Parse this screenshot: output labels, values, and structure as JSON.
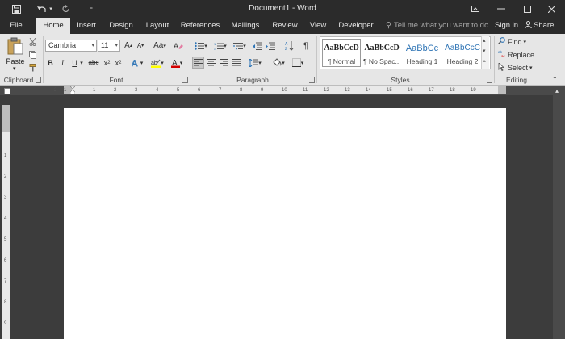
{
  "window": {
    "title": "Document1 - Word"
  },
  "quick_access": {
    "save_icon": "save-icon",
    "undo_icon": "undo-icon",
    "redo_icon": "redo-icon",
    "customize_icon": "customize-icon"
  },
  "tabs": [
    {
      "label": "File"
    },
    {
      "label": "Home"
    },
    {
      "label": "Insert"
    },
    {
      "label": "Design"
    },
    {
      "label": "Layout"
    },
    {
      "label": "References"
    },
    {
      "label": "Mailings"
    },
    {
      "label": "Review"
    },
    {
      "label": "View"
    },
    {
      "label": "Developer"
    }
  ],
  "tell_me": "Tell me what you want to do...",
  "signin": "Sign in",
  "share": "Share",
  "clipboard": {
    "paste_label": "Paste",
    "group_label": "Clipboard"
  },
  "font": {
    "font_name": "Cambria",
    "font_size": "11",
    "group_label": "Font",
    "case_label": "Aa"
  },
  "paragraph": {
    "group_label": "Paragraph"
  },
  "styles": {
    "group_label": "Styles",
    "items": [
      {
        "preview": "AaBbCcD",
        "name": "¶ Normal"
      },
      {
        "preview": "AaBbCcD",
        "name": "¶ No Spac..."
      },
      {
        "preview": "AaBbCc",
        "name": "Heading 1"
      },
      {
        "preview": "AaBbCcC",
        "name": "Heading 2"
      }
    ]
  },
  "editing": {
    "find": "Find",
    "replace": "Replace",
    "select": "Select",
    "group_label": "Editing"
  },
  "ruler": {
    "h_ticks": [
      "2",
      "1",
      "1",
      "2",
      "3",
      "4",
      "5",
      "6",
      "7",
      "8",
      "9",
      "10",
      "11",
      "12",
      "13",
      "14",
      "15",
      "16",
      "17",
      "18",
      "19"
    ],
    "v_ticks": [
      "1",
      "2",
      "3",
      "4",
      "5",
      "6",
      "7",
      "8",
      "9"
    ]
  },
  "colors": {
    "titlebar": "#2b2b2b",
    "ribbon": "#e6e6e6",
    "workspace": "#3c3c3c",
    "page": "#ffffff",
    "heading_blue": "#2e74b5",
    "font_color_red": "#d40000",
    "highlight_yellow": "#ffff00"
  }
}
